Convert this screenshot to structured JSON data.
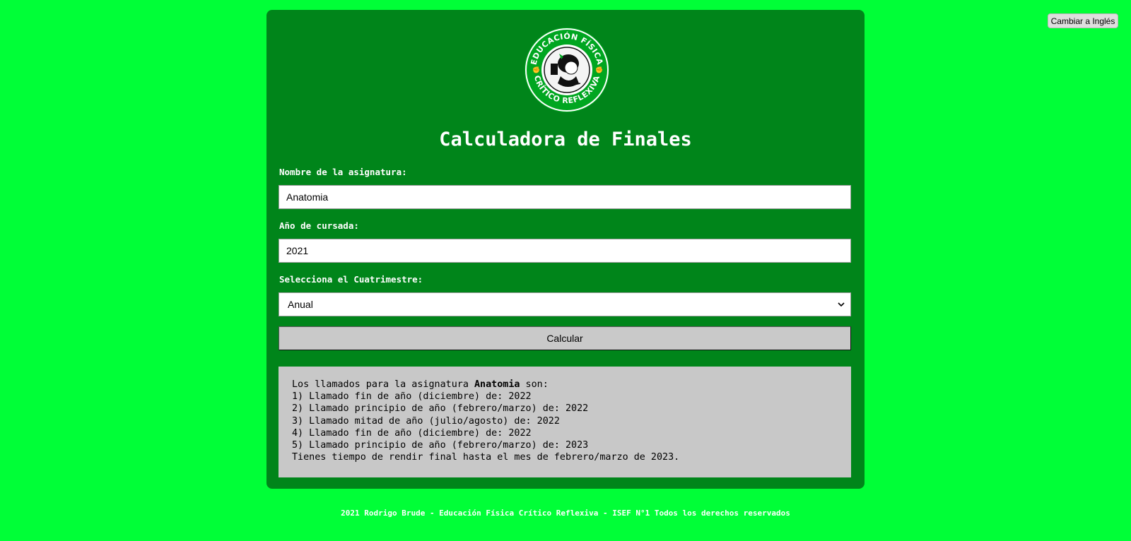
{
  "header": {
    "language_button": "Cambiar a Inglés"
  },
  "logo": {
    "top_text": "EDUCACIÓN FÍSICA",
    "bottom_text": "CRÍTICO REFLEXIVA"
  },
  "title": "Calculadora de Finales",
  "form": {
    "subject_label": "Nombre de la asignatura:",
    "subject_value": "Anatomia",
    "year_label": "Año de cursada:",
    "year_value": "2021",
    "term_label": "Selecciona el Cuatrimestre:",
    "term_value": "Anual",
    "calculate_label": "Calcular"
  },
  "result": {
    "intro_prefix": "Los llamados para la asignatura ",
    "subject": "Anatomia",
    "intro_suffix": " son:",
    "lines": [
      "1) Llamado fin de año (diciembre) de: 2022",
      "2) Llamado principio de año (febrero/marzo) de: 2022",
      "3) Llamado mitad de año (julio/agosto) de: 2022",
      "4) Llamado fin de año (diciembre) de: 2022",
      "5) Llamado principio de año (febrero/marzo) de: 2023"
    ],
    "conclusion": "Tienes tiempo de rendir final hasta el mes de febrero/marzo de 2023."
  },
  "footer": "2021 Rodrigo Brude - Educación Física Crítico Reflexiva - ISEF N°1 Todos los derechos reservados",
  "colors": {
    "page_background": "#00ff37",
    "card_background": "#00851a",
    "result_background": "#c8c8c8"
  }
}
